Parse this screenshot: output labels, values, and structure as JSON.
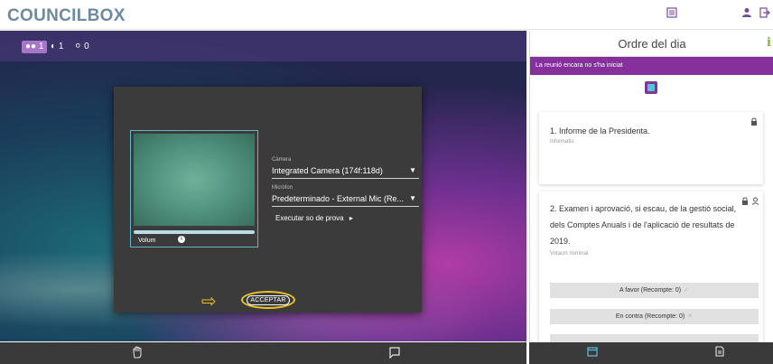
{
  "app": {
    "logo": "COUNCILBOX",
    "header_icons": [
      "list-icon",
      "user-icon",
      "logout-icon"
    ]
  },
  "video": {
    "participants_count": "1",
    "online_count": "1",
    "offline_count": "0"
  },
  "device_dialog": {
    "volume_label": "Volum",
    "camera_label": "Càmera",
    "camera_value": "Integrated Camera (174f:118d)",
    "mic_label": "Micròfon",
    "mic_value": "Predeterminado - External Mic (Re...",
    "test_sound_label": "Executar so de prova",
    "accept_label": "ACCEPTAR"
  },
  "agenda": {
    "title": "Ordre del dia",
    "status": "La reunió encara no s'ha iniciat",
    "items": [
      {
        "title": "1. Informe de la Presidenta.",
        "subtitle": "Informatiu"
      },
      {
        "title_line1": "2. Examen i aprovació, si escau, de la gestió social,",
        "title_line2": "dels Comptes Anuals i de l'aplicació de resultats de",
        "title_line3": "2019.",
        "subtitle": "Votació nominal",
        "vote_options": [
          "A favor (Recompte: 0)",
          "En contra (Recompte: 0)"
        ]
      }
    ]
  },
  "colors": {
    "brand_purple": "#86309b",
    "logo_gray_blue": "#6d8aa0",
    "highlight_yellow": "#e7c126",
    "info_green": "#7bb33b"
  }
}
